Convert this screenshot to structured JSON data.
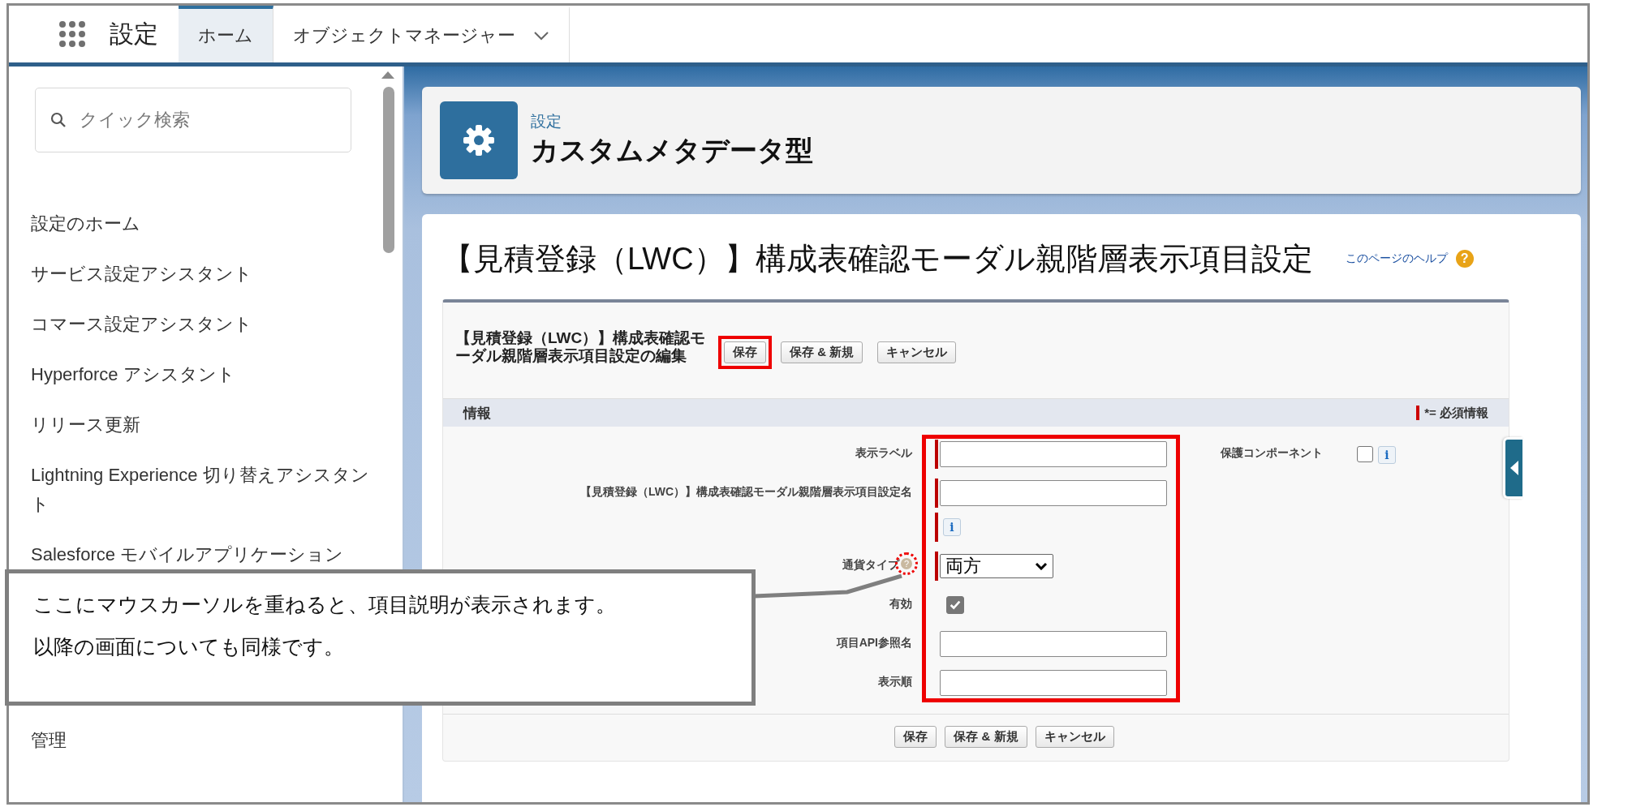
{
  "app": {
    "name": "設定"
  },
  "tabs": [
    {
      "label": "ホーム",
      "selected": true,
      "has_menu": false
    },
    {
      "label": "オブジェクトマネージャー",
      "selected": false,
      "has_menu": true
    }
  ],
  "sidebar": {
    "search": {
      "placeholder": "クイック検索"
    },
    "items": [
      {
        "label": "設定のホーム",
        "kind": "link"
      },
      {
        "label": "サービス設定アシスタント",
        "kind": "link"
      },
      {
        "label": "コマース設定アシスタント",
        "kind": "link"
      },
      {
        "label": "Hyperforce アシスタント",
        "kind": "link"
      },
      {
        "label": "リリース更新",
        "kind": "link"
      },
      {
        "label": "Lightning Experience 切り替えアシスタント",
        "kind": "link"
      },
      {
        "label": "Salesforce モバイルアプリケーション",
        "kind": "link"
      },
      {
        "label": "管理",
        "kind": "section"
      }
    ]
  },
  "header": {
    "breadcrumb": "設定",
    "title": "カスタムメタデータ型"
  },
  "page": {
    "title": "【見積登録（LWC）】構成表確認モーダル親階層表示項目設定",
    "help_link": "このページのヘルプ",
    "help_icon": "?"
  },
  "form": {
    "title": "【見積登録（LWC）】構成表確認モーダル親階層表示項目設定の編集",
    "buttons": [
      {
        "label": "保存",
        "highlighted": true
      },
      {
        "label": "保存 & 新規",
        "highlighted": false
      },
      {
        "label": "キャンセル",
        "highlighted": false
      }
    ],
    "section": "情報",
    "required_legend": "*= 必須情報",
    "fields": [
      {
        "label": "表示ラベル",
        "kind": "text",
        "required": true
      },
      {
        "label": "【見積登録（LWC）】構成表確認モーダル親階層表示項目設定名",
        "kind": "text",
        "required": true,
        "info_icon": "i"
      },
      {
        "label": "通貨タイプ",
        "kind": "select",
        "required": true,
        "help_icon": "?",
        "value": "両方"
      },
      {
        "label": "有効",
        "kind": "checkbox",
        "required": false,
        "checked": true
      },
      {
        "label": "項目API参照名",
        "kind": "text",
        "required": false
      },
      {
        "label": "表示順",
        "kind": "text",
        "required": false
      }
    ],
    "side_field": {
      "label": "保護コンポーネント",
      "checked": false,
      "info_icon": "i"
    },
    "bottom_buttons": [
      {
        "label": "保存"
      },
      {
        "label": "保存 & 新規"
      },
      {
        "label": "キャンセル"
      }
    ]
  },
  "callout": {
    "lines": [
      "ここにマウスカーソルを重ねると、項目説明が表示されます。",
      "以降の画面についても同様です。"
    ]
  }
}
